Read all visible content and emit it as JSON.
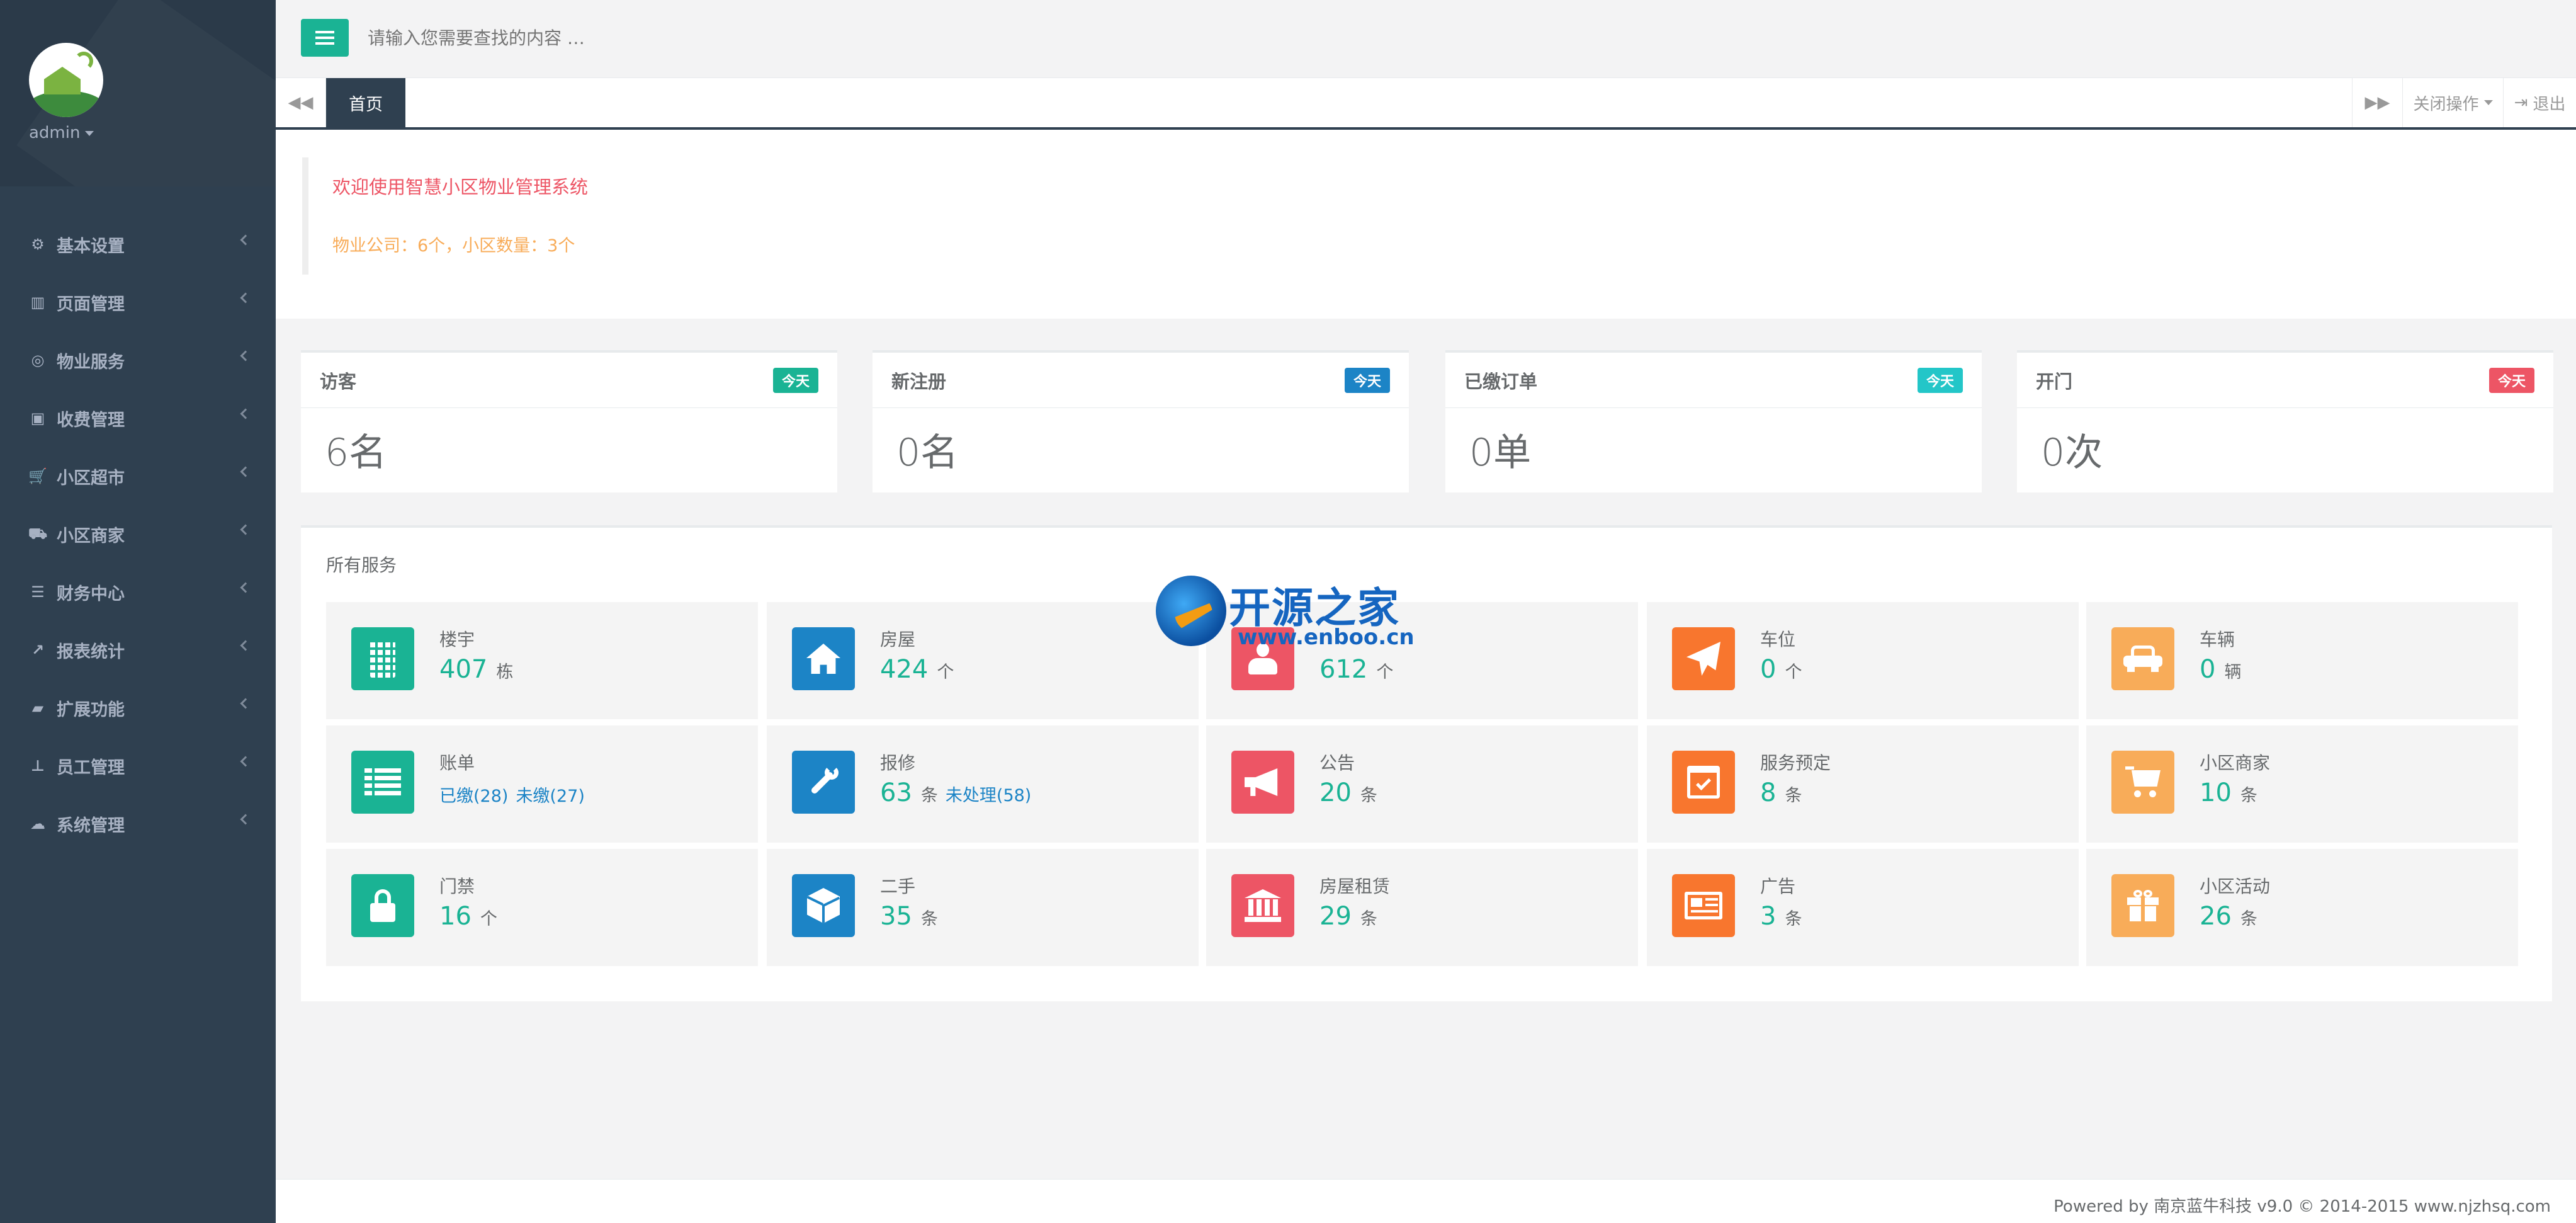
{
  "sidebar": {
    "user": "admin",
    "items": [
      {
        "label": "基本设置",
        "icon": "gear-icon"
      },
      {
        "label": "页面管理",
        "icon": "columns-icon"
      },
      {
        "label": "物业服务",
        "icon": "life-ring-icon"
      },
      {
        "label": "收费管理",
        "icon": "money-icon"
      },
      {
        "label": "小区超市",
        "icon": "cart-icon"
      },
      {
        "label": "小区商家",
        "icon": "truck-icon"
      },
      {
        "label": "财务中心",
        "icon": "database-icon"
      },
      {
        "label": "报表统计",
        "icon": "line-chart-icon"
      },
      {
        "label": "扩展功能",
        "icon": "folder-open-icon"
      },
      {
        "label": "员工管理",
        "icon": "sitemap-icon"
      },
      {
        "label": "系统管理",
        "icon": "cloud-icon"
      }
    ]
  },
  "topbar": {
    "search_placeholder": "请输入您需要查找的内容 …"
  },
  "tabs": {
    "active": "首页",
    "close_ops": "关闭操作",
    "logout": "退出"
  },
  "welcome": {
    "title": "欢迎使用智慧小区物业管理系统",
    "subtitle": "物业公司：6个，小区数量：3个"
  },
  "stats": [
    {
      "title": "访客",
      "badge": "今天",
      "badge_color": "#1ab394",
      "value": "6名"
    },
    {
      "title": "新注册",
      "badge": "今天",
      "badge_color": "#1c84c6",
      "value": "0名"
    },
    {
      "title": "已缴订单",
      "badge": "今天",
      "badge_color": "#23c6c8",
      "value": "0单"
    },
    {
      "title": "开门",
      "badge": "今天",
      "badge_color": "#ed5565",
      "value": "0次"
    }
  ],
  "services": {
    "title": "所有服务",
    "items": [
      {
        "name": "楼宇",
        "num": "407",
        "unit": "栋",
        "icon": "building-icon",
        "color": "#1ab394"
      },
      {
        "name": "房屋",
        "num": "424",
        "unit": "个",
        "icon": "home-icon",
        "color": "#1c84c6"
      },
      {
        "name": "",
        "num": "612",
        "unit": "个",
        "icon": "user-icon",
        "color": "#ed5565"
      },
      {
        "name": "车位",
        "num": "0",
        "unit": "个",
        "icon": "paper-plane-icon",
        "color": "#f8762e"
      },
      {
        "name": "车辆",
        "num": "0",
        "unit": "辆",
        "icon": "car-icon",
        "color": "#f8ac59"
      },
      {
        "name": "账单",
        "num": "",
        "unit": "",
        "link1": "已缴(28)",
        "link2": "未缴(27)",
        "icon": "list-icon",
        "color": "#1ab394"
      },
      {
        "name": "报修",
        "num": "63",
        "unit": "条",
        "link2": "未处理(58)",
        "icon": "wrench-icon",
        "color": "#1c84c6"
      },
      {
        "name": "公告",
        "num": "20",
        "unit": "条",
        "icon": "bullhorn-icon",
        "color": "#ed5565"
      },
      {
        "name": "服务预定",
        "num": "8",
        "unit": "条",
        "icon": "calendar-check-icon",
        "color": "#f8762e"
      },
      {
        "name": "小区商家",
        "num": "10",
        "unit": "条",
        "icon": "cart-icon",
        "color": "#f8ac59"
      },
      {
        "name": "门禁",
        "num": "16",
        "unit": "个",
        "icon": "lock-icon",
        "color": "#1ab394"
      },
      {
        "name": "二手",
        "num": "35",
        "unit": "条",
        "icon": "cube-icon",
        "color": "#1c84c6"
      },
      {
        "name": "房屋租赁",
        "num": "29",
        "unit": "条",
        "icon": "bank-icon",
        "color": "#ed5565"
      },
      {
        "name": "广告",
        "num": "3",
        "unit": "条",
        "icon": "newspaper-icon",
        "color": "#f8762e"
      },
      {
        "name": "小区活动",
        "num": "26",
        "unit": "条",
        "icon": "gift-icon",
        "color": "#f8ac59"
      }
    ]
  },
  "watermark": {
    "title": "开源之家",
    "url": "www.enboo.cn"
  },
  "footer": {
    "text": "Powered by 南京蓝牛科技 v9.0 © 2014-2015 www.njzhsq.com"
  }
}
